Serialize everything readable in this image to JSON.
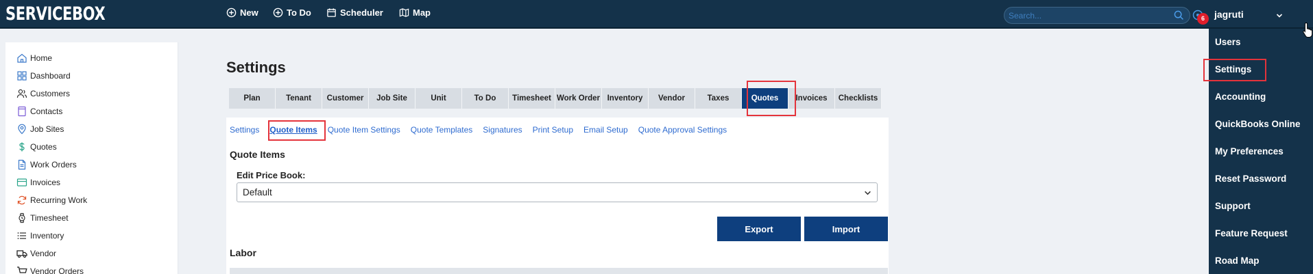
{
  "app": {
    "logo": "SERVICEBOX"
  },
  "topnav": {
    "items": [
      {
        "label": "New",
        "icon": "plus-circle-icon"
      },
      {
        "label": "To Do",
        "icon": "plus-circle-icon"
      },
      {
        "label": "Scheduler",
        "icon": "calendar-icon"
      },
      {
        "label": "Map",
        "icon": "map-icon"
      }
    ],
    "search_placeholder": "Search...",
    "notification_count": "6",
    "username": "jagruti"
  },
  "sidebar": {
    "items": [
      {
        "label": "Home",
        "icon": "home-icon"
      },
      {
        "label": "Dashboard",
        "icon": "dashboard-icon"
      },
      {
        "label": "Customers",
        "icon": "users-icon"
      },
      {
        "label": "Contacts",
        "icon": "contact-book-icon"
      },
      {
        "label": "Job Sites",
        "icon": "location-pin-icon"
      },
      {
        "label": "Quotes",
        "icon": "dollar-icon"
      },
      {
        "label": "Work Orders",
        "icon": "document-icon"
      },
      {
        "label": "Invoices",
        "icon": "invoice-icon"
      },
      {
        "label": "Recurring Work",
        "icon": "recurring-icon"
      },
      {
        "label": "Timesheet",
        "icon": "watch-icon"
      },
      {
        "label": "Inventory",
        "icon": "list-icon"
      },
      {
        "label": "Vendor",
        "icon": "truck-icon"
      },
      {
        "label": "Vendor Orders",
        "icon": "cart-icon"
      }
    ]
  },
  "main": {
    "title": "Settings",
    "tabs": [
      "Plan",
      "Tenant",
      "Customer",
      "Job Site",
      "Unit",
      "To Do",
      "Timesheet",
      "Work Order",
      "Inventory",
      "Vendor",
      "Taxes",
      "Quotes",
      "Invoices",
      "Checklists"
    ],
    "active_tab": "Quotes",
    "subtabs": [
      "Settings",
      "Quote Items",
      "Quote Item Settings",
      "Quote Templates",
      "Signatures",
      "Print Setup",
      "Email Setup",
      "Quote Approval Settings"
    ],
    "active_subtab": "Quote Items",
    "section_title": "Quote Items",
    "price_book_label": "Edit Price Book:",
    "price_book_value": "Default",
    "export_label": "Export",
    "import_label": "Import",
    "labor_title": "Labor"
  },
  "user_menu": {
    "items": [
      "Users",
      "Settings",
      "Accounting",
      "QuickBooks Online",
      "My Preferences",
      "Reset Password",
      "Support",
      "Feature Request",
      "Road Map"
    ],
    "highlighted": "Settings"
  },
  "colors": {
    "topbar": "#14324a",
    "primary_button": "#0e3f7e",
    "link": "#2e6bd0",
    "highlight_border": "#e4333b",
    "badge": "#e01e2b"
  }
}
